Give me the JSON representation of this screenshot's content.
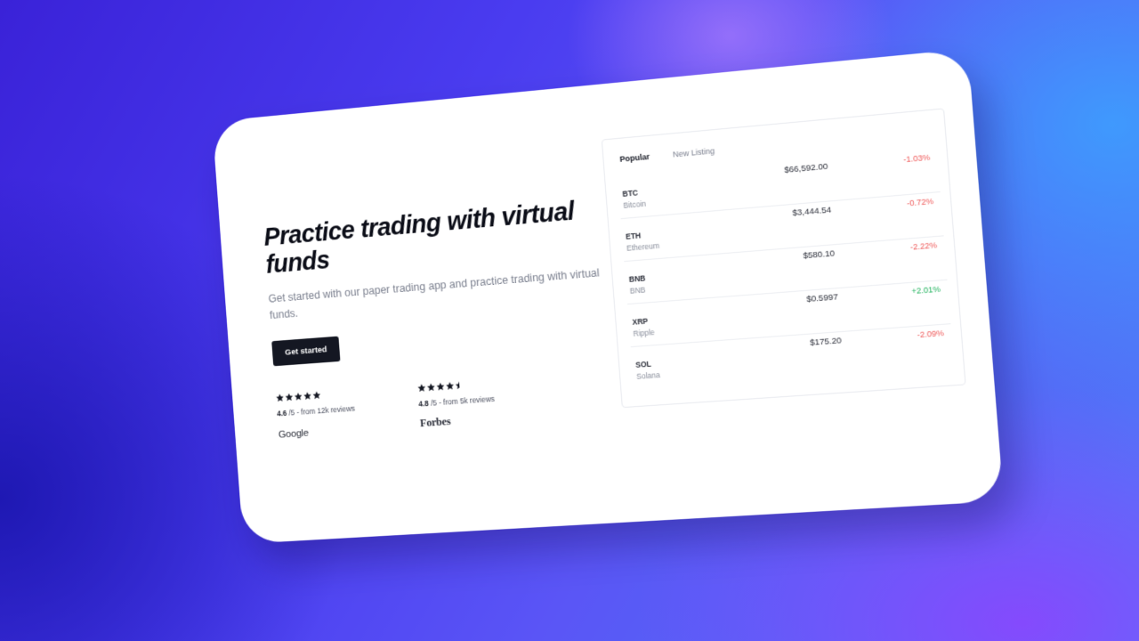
{
  "colors": {
    "accent": "#141722",
    "negative": "#ef5a5a",
    "positive": "#22b35e"
  },
  "hero": {
    "title": "Practice trading with virtual funds",
    "subtitle": "Get started with our paper trading app and practice trading with virtual funds.",
    "cta_label": "Get started"
  },
  "ratings": [
    {
      "score": "4.6",
      "suffix": "/5 - from 12k reviews",
      "stars": 5,
      "source": "Google"
    },
    {
      "score": "4.8",
      "suffix": "/5 - from 5k reviews",
      "stars": 4.5,
      "source": "Forbes"
    }
  ],
  "market": {
    "tabs": [
      {
        "label": "Popular",
        "active": true
      },
      {
        "label": "New Listing",
        "active": false
      }
    ],
    "rows": [
      {
        "symbol": "BTC",
        "name": "Bitcoin",
        "price": "$66,592.00",
        "change": "-1.03%",
        "direction": "neg"
      },
      {
        "symbol": "ETH",
        "name": "Ethereum",
        "price": "$3,444.54",
        "change": "-0.72%",
        "direction": "neg"
      },
      {
        "symbol": "BNB",
        "name": "BNB",
        "price": "$580.10",
        "change": "-2.22%",
        "direction": "neg"
      },
      {
        "symbol": "XRP",
        "name": "Ripple",
        "price": "$0.5997",
        "change": "+2.01%",
        "direction": "pos"
      },
      {
        "symbol": "SOL",
        "name": "Solana",
        "price": "$175.20",
        "change": "-2.09%",
        "direction": "neg"
      }
    ]
  }
}
